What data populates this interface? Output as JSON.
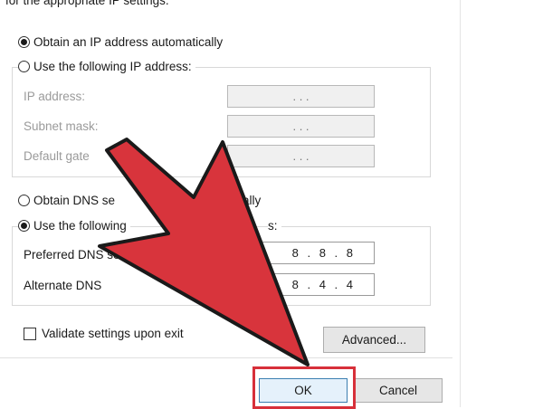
{
  "header_text": "for the appropriate IP settings.",
  "ip_section": {
    "auto_label": "Obtain an IP address automatically",
    "manual_label": "Use the following IP address:",
    "fields": [
      {
        "label": "IP address:",
        "value": ".    .    ."
      },
      {
        "label": "Subnet mask:",
        "value": ".    .    ."
      },
      {
        "label": "Default gate",
        "value": ".    .    ."
      }
    ]
  },
  "dns_section": {
    "auto_label": "Obtain DNS se",
    "auto_label_tail": "ally",
    "manual_label": "Use the following",
    "manual_label_tail": "s:",
    "preferred_label": "Preferred DNS serv",
    "preferred_value": "8 . 8 . 8",
    "alternate_label": "Alternate DNS",
    "alternate_value": "8 . 4 . 4"
  },
  "validate_label": "Validate settings upon exit",
  "buttons": {
    "advanced": "Advanced...",
    "ok": "OK",
    "cancel": "Cancel"
  },
  "colors": {
    "arrow_fill": "#d8343c",
    "highlight": "#d7303a"
  }
}
